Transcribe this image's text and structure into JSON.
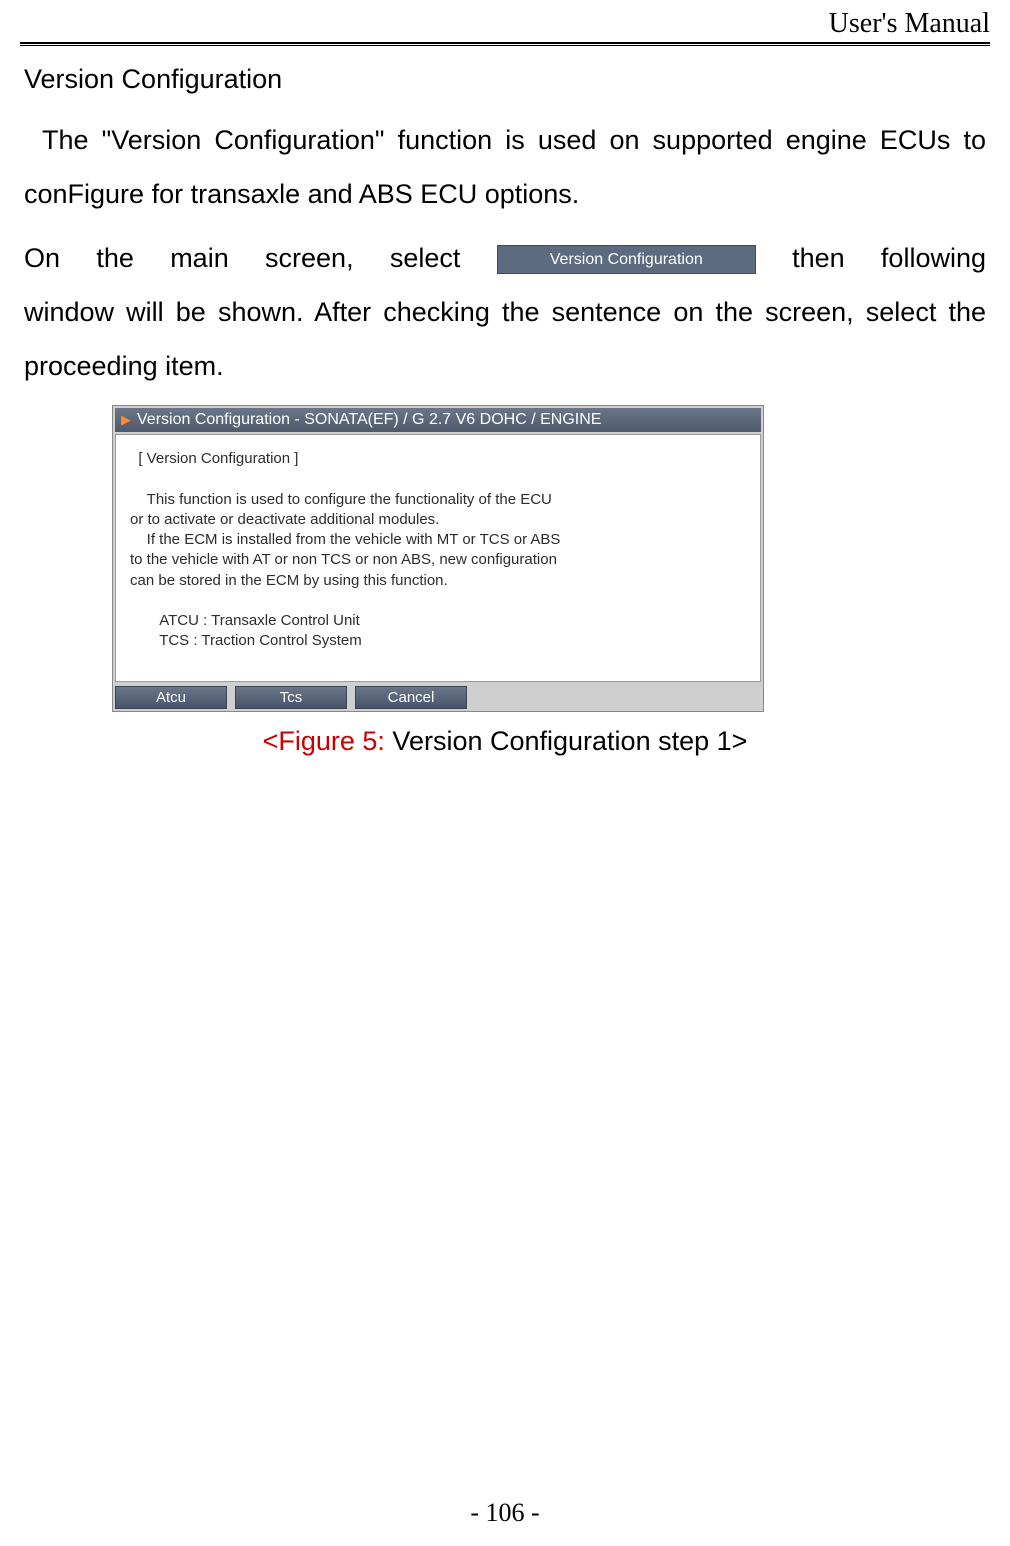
{
  "header": {
    "title": "User's Manual"
  },
  "section": {
    "title": "Version Configuration",
    "para1": "The \"Version Configuration\" function is used on supported engine ECUs to conFigure for transaxle and ABS ECU options.",
    "para2_part1": "On the main screen, select ",
    "inline_button": "Version Configuration",
    "para2_part2": " then following",
    "para2_line2": "window will be shown. After checking the sentence on the screen, select the proceeding item."
  },
  "dialog": {
    "title": "Version Configuration - SONATA(EF) / G 2.7 V6 DOHC / ENGINE",
    "body": "  [ Version Configuration ]\n\n    This function is used to configure the functionality of the ECU\nor to activate or deactivate additional modules.\n    If the ECM is installed from the vehicle with MT or TCS or ABS\nto the vehicle with AT or non TCS or non ABS, new configuration\ncan be stored in the ECM by using this function.\n\n       ATCU : Transaxle Control Unit\n       TCS : Traction Control System",
    "buttons": {
      "atcu": "Atcu",
      "tcs": "Tcs",
      "cancel": "Cancel"
    }
  },
  "caption": {
    "prefix": "<Figure 5:",
    "rest": " Version Configuration step 1>"
  },
  "page_number": "- 106 -"
}
